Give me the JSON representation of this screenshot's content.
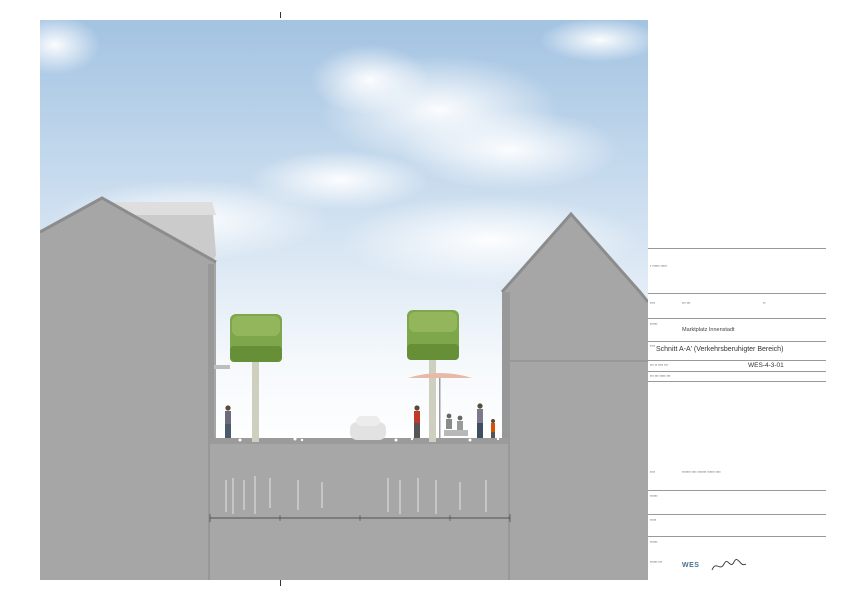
{
  "drawing": {
    "colors": {
      "sky_top": "#a9c6e3",
      "sky_bottom": "#f4f7fb",
      "building": "#a4a4a4",
      "building_dark": "#8a8a8a",
      "roof_light": "#c8c8c8",
      "foliage": "#7fa84a",
      "foliage_dark": "#5d8a33",
      "trunk": "#c9c9b8",
      "ground": "#a6a6a6",
      "umbrella": "#e8b8a8"
    },
    "elements": [
      "sky",
      "left-house",
      "right-house",
      "tree",
      "tree",
      "pedestrian",
      "cafe-umbrella",
      "car",
      "street-ground",
      "utility-lines",
      "dimension-line"
    ]
  },
  "title_block": {
    "project": "Marktplatz Innenstadt",
    "plan_title": "Schnitt A-A' (Verkehrsberuhigter Bereich)",
    "plan_number": "WES-4-3-01",
    "logo": "WES"
  }
}
